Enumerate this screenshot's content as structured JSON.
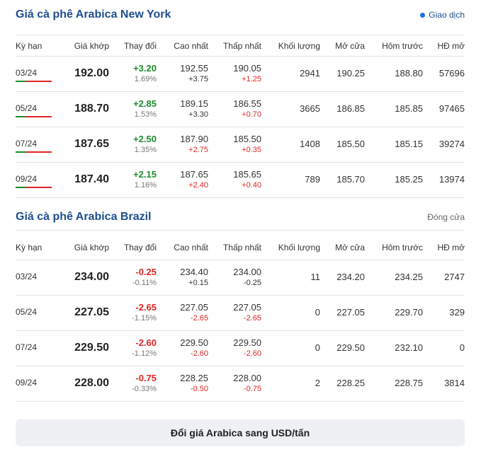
{
  "columns": [
    "Kỳ hạn",
    "Giá khớp",
    "Thay đổi",
    "Cao nhất",
    "Thấp nhất",
    "Khối lượng",
    "Mở cửa",
    "Hôm trước",
    "HĐ mở"
  ],
  "colors": {
    "up": "#1e8a2e",
    "down": "#e02424",
    "title": "#1f4e8c",
    "status_dot": "#1a73e8"
  },
  "ny": {
    "title": "Giá cà phê Arabica New York",
    "status": "Giao dịch",
    "rows": [
      {
        "term": "03/24",
        "price": "192.00",
        "change": "+3.20",
        "change_pct": "1.69%",
        "high": "192.55",
        "high_diff": "+3.75",
        "low": "190.05",
        "low_diff": "+1.25",
        "volume": "2941",
        "open": "190.25",
        "prev": "188.80",
        "oi": "57696",
        "range_position": 0.3
      },
      {
        "term": "05/24",
        "price": "188.70",
        "change": "+2.85",
        "change_pct": "1.53%",
        "high": "189.15",
        "high_diff": "+3.30",
        "low": "186.55",
        "low_diff": "+0.70",
        "volume": "3665",
        "open": "186.85",
        "prev": "185.85",
        "oi": "97465",
        "range_position": 0.25
      },
      {
        "term": "07/24",
        "price": "187.65",
        "change": "+2.50",
        "change_pct": "1.35%",
        "high": "187.90",
        "high_diff": "+2.75",
        "low": "185.50",
        "low_diff": "+0.35",
        "volume": "1408",
        "open": "185.50",
        "prev": "185.15",
        "oi": "39274",
        "range_position": 0.3
      },
      {
        "term": "09/24",
        "price": "187.40",
        "change": "+2.15",
        "change_pct": "1.16%",
        "high": "187.65",
        "high_diff": "+2.40",
        "low": "185.65",
        "low_diff": "+0.40",
        "volume": "789",
        "open": "185.70",
        "prev": "185.25",
        "oi": "13974",
        "range_position": 0.3
      }
    ]
  },
  "br": {
    "title": "Giá cà phê Arabica Brazil",
    "status": "Đóng cửa",
    "rows": [
      {
        "term": "03/24",
        "price": "234.00",
        "change": "-0.25",
        "change_pct": "-0.11%",
        "high": "234.40",
        "high_diff": "+0.15",
        "low": "234.00",
        "low_diff": "-0.25",
        "volume": "11",
        "open": "234.20",
        "prev": "234.25",
        "oi": "2747"
      },
      {
        "term": "05/24",
        "price": "227.05",
        "change": "-2.65",
        "change_pct": "-1.15%",
        "high": "227.05",
        "high_diff": "-2.65",
        "low": "227.05",
        "low_diff": "-2.65",
        "volume": "0",
        "open": "227.05",
        "prev": "229.70",
        "oi": "329"
      },
      {
        "term": "07/24",
        "price": "229.50",
        "change": "-2.60",
        "change_pct": "-1.12%",
        "high": "229.50",
        "high_diff": "-2.60",
        "low": "229.50",
        "low_diff": "-2.60",
        "volume": "0",
        "open": "229.50",
        "prev": "232.10",
        "oi": "0"
      },
      {
        "term": "09/24",
        "price": "228.00",
        "change": "-0.75",
        "change_pct": "-0.33%",
        "high": "228.25",
        "high_diff": "-0.50",
        "low": "228.00",
        "low_diff": "-0.75",
        "volume": "2",
        "open": "228.25",
        "prev": "228.75",
        "oi": "3814"
      }
    ]
  },
  "convert_button": "Đổi giá Arabica sang USD/tấn"
}
